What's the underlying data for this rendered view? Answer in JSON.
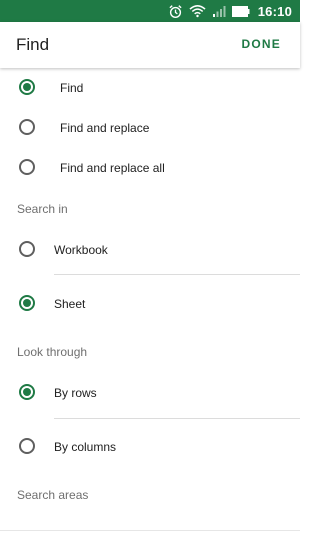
{
  "status_bar": {
    "icons": [
      "alarm-icon",
      "wifi-icon",
      "signal-icon",
      "battery-icon"
    ],
    "time": "16:10",
    "background_color": "#1f7a45"
  },
  "app_bar": {
    "title": "Find",
    "done_label": "DONE",
    "accent_color": "#1f7a45"
  },
  "find_mode": {
    "options": [
      {
        "label": "Find",
        "checked": true
      },
      {
        "label": "Find and replace",
        "checked": false
      },
      {
        "label": "Find and replace all",
        "checked": false
      }
    ]
  },
  "search_in": {
    "header": "Search in",
    "options": [
      {
        "label": "Workbook",
        "checked": false
      },
      {
        "label": "Sheet",
        "checked": true
      }
    ]
  },
  "look_through": {
    "header": "Look through",
    "options": [
      {
        "label": "By rows",
        "checked": true
      },
      {
        "label": "By columns",
        "checked": false
      }
    ]
  },
  "search_areas": {
    "header": "Search areas"
  }
}
